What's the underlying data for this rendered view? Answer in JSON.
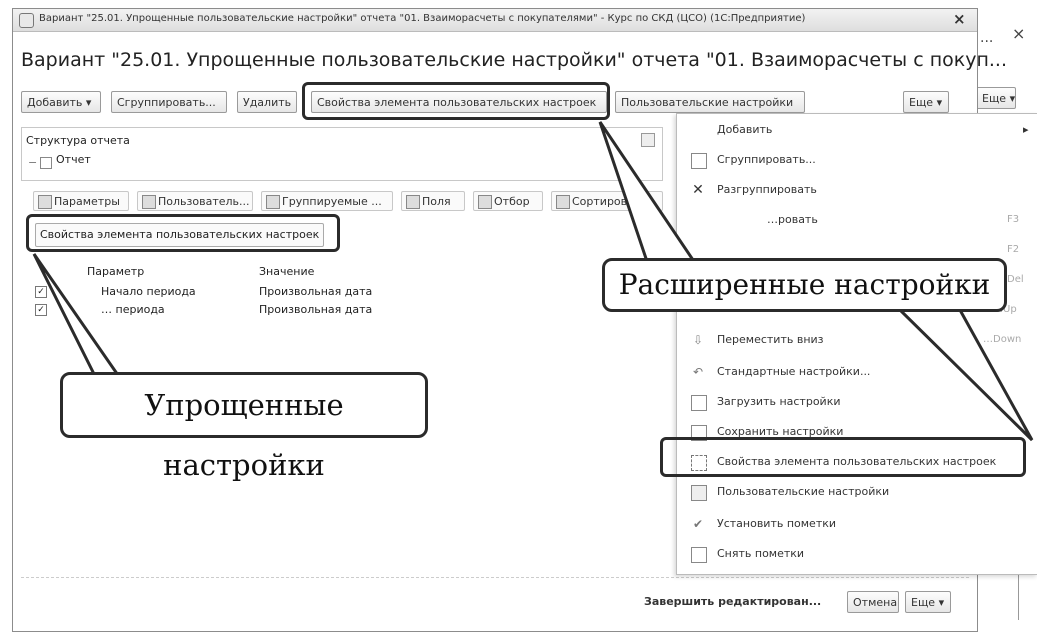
{
  "window": {
    "titlebar": "Вариант \"25.01. Упрощенные пользовательские настройки\" отчета \"01. Взаиморасчеты с покупателями\" - Курс по СКД (ЦСО) (1С:Предприятие)",
    "close": "×",
    "outer_close": "×",
    "outer_dots": "..."
  },
  "header": {
    "title": "Вариант \"25.01. Упрощенные пользовательские настройки\" отчета \"01. Взаиморасчеты с покуп..."
  },
  "toolbar": {
    "add": "Добавить ▾",
    "group": "Сгруппировать...",
    "delete": "Удалить",
    "props": "Свойства элемента пользовательских настроек",
    "user_settings": "Пользовательские настройки",
    "more": "Еще ▾",
    "outer_more": "Еще ▾"
  },
  "structure": {
    "label": "Структура отчета",
    "node": "Отчет"
  },
  "tabs": [
    "Параметры",
    "Пользователь...",
    "Группируемые ...",
    "Поля",
    "Отбор",
    "Сортировка"
  ],
  "props_link": "Свойства элемента пользовательских настроек",
  "params_table": {
    "headers": [
      "Параметр",
      "Значение"
    ],
    "rows": [
      {
        "param": "Начало периода",
        "value": "Произвольная дата"
      },
      {
        "param": "… периода",
        "value": "Произвольная дата"
      }
    ]
  },
  "menu": {
    "items": [
      {
        "icon": "plus-icon",
        "label": "Добавить",
        "hint": "▸"
      },
      {
        "icon": "group-icon",
        "label": "Сгруппировать...",
        "hint": ""
      },
      {
        "icon": "ungroup-x-icon",
        "label": "Разгруппировать",
        "hint": ""
      },
      {
        "icon": "copy-icon",
        "label": "…ровать",
        "hint": "F3"
      },
      {
        "icon": "blank-icon",
        "label": "",
        "hint": "F2"
      },
      {
        "icon": "blank-icon",
        "label": "",
        "hint": "Del"
      },
      {
        "icon": "move-up-icon",
        "label": "",
        "hint": "…Up"
      },
      {
        "icon": "move-down-icon",
        "label": "Переместить вниз",
        "hint": "…Down"
      },
      {
        "icon": "standard-settings-icon",
        "label": "Стандартные настройки...",
        "hint": ""
      },
      {
        "icon": "load-settings-icon",
        "label": "Загрузить настройки",
        "hint": ""
      },
      {
        "icon": "save-settings-icon",
        "label": "Сохранить настройки",
        "hint": ""
      },
      {
        "icon": "element-props-icon",
        "label": "Свойства элемента пользовательских настроек",
        "hint": ""
      },
      {
        "icon": "user-settings-icon",
        "label": "Пользовательские настройки",
        "hint": ""
      },
      {
        "icon": "set-marks-icon",
        "label": "Установить пометки",
        "hint": ""
      },
      {
        "icon": "clear-marks-icon",
        "label": "Снять пометки",
        "hint": ""
      }
    ]
  },
  "callouts": {
    "advanced": "Расширенные настройки",
    "simplified": "Упрощенные настройки"
  },
  "footer": {
    "finish": "Завершить редактирован...",
    "cancel": "Отмена",
    "more": "Еще ▾"
  }
}
